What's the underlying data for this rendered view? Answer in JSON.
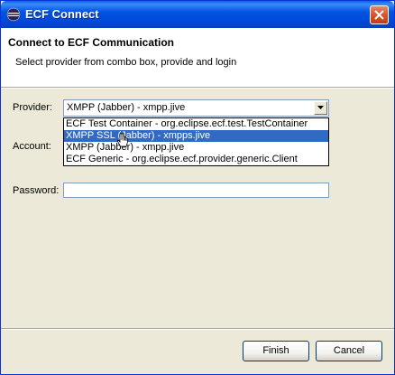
{
  "window": {
    "title": "ECF Connect",
    "icon": "eclipse-icon"
  },
  "header": {
    "title": "Connect to ECF Communication",
    "description": "Select provider from combo box, provide and login"
  },
  "form": {
    "provider_label": "Provider:",
    "provider_value": "XMPP (Jabber) - xmpp.jive",
    "provider_options": [
      "ECF Test Container - org.eclipse.ecf.test.TestContainer",
      "XMPP SSL (Jabber) - xmpps.jive",
      "XMPP (Jabber) - xmpp.jive",
      "ECF Generic - org.eclipse.ecf.provider.generic.Client"
    ],
    "highlighted_option": "XMPP SSL (Jabber) - xmpps.jive",
    "account_label": "Account:",
    "account_value": "",
    "password_label": "Password:",
    "password_value": ""
  },
  "buttons": {
    "finish": "Finish",
    "cancel": "Cancel"
  }
}
